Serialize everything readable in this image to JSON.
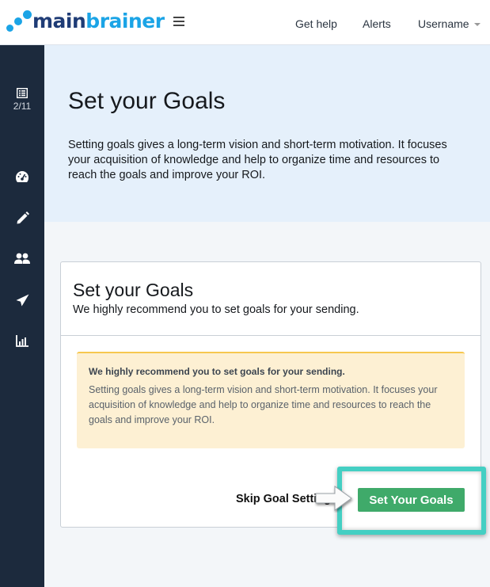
{
  "header": {
    "logo": {
      "main": "main",
      "brainer": "brainer"
    },
    "nav": {
      "get_help": "Get help",
      "alerts": "Alerts",
      "username": "Username"
    }
  },
  "sidebar": {
    "items": [
      {
        "icon": "list-icon",
        "label": "2/11"
      },
      {
        "icon": "dashboard-gauge-icon"
      },
      {
        "icon": "pencil-icon"
      },
      {
        "icon": "users-icon"
      },
      {
        "icon": "paper-plane-icon"
      },
      {
        "icon": "bar-chart-icon"
      }
    ]
  },
  "hero": {
    "title": "Set your Goals",
    "description": "Setting goals gives a long-term vision and short-term motivation. It focuses your acquisition of knowledge and help to organize time and resources to reach the goals and improve your ROI."
  },
  "card": {
    "title": "Set your Goals",
    "subtitle": "We highly recommend you to set goals for your sending.",
    "alert": {
      "heading": "We highly recommend you to set goals for your sending.",
      "body": "Setting goals gives a long-term vision and short-term motivation. It focuses your acquisition of knowledge and help to organize time and resources to reach the goals and improve your ROI."
    },
    "skip_label": "Skip Goal Setting",
    "primary_label": "Set Your Goals"
  },
  "colors": {
    "brand_dark": "#1f3c76",
    "brand_light": "#1ba4e6",
    "sidebar_bg": "#1c2a3d",
    "primary_button": "#3faa6a",
    "highlight": "#44cfc3",
    "alert_bg": "#fdf0d3",
    "alert_border": "#f7c84f"
  }
}
